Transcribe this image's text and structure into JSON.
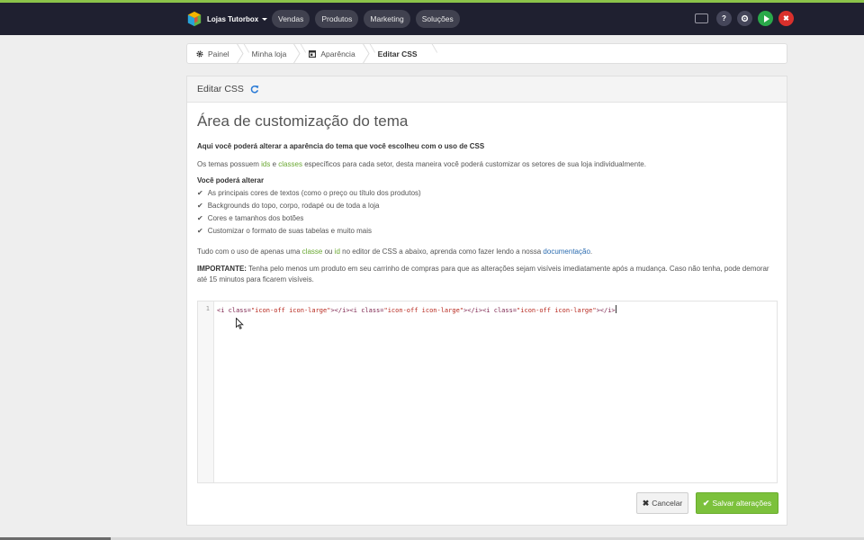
{
  "topbar": {
    "brand": "Lojas Tutorbox",
    "nav": [
      "Vendas",
      "Produtos",
      "Marketing",
      "Soluções"
    ],
    "actions": [
      "screen-icon",
      "question-icon",
      "gear-icon",
      "play-icon",
      "close-icon"
    ],
    "colors": {
      "bar": "#1f2030",
      "accent_stripe": "#8bc34a",
      "green": "#2aa94a",
      "red": "#d9302c"
    }
  },
  "breadcrumb": {
    "items": [
      {
        "label": "Painel",
        "icon": "gear-icon"
      },
      {
        "label": "Minha loja",
        "icon": ""
      },
      {
        "label": "Aparência",
        "icon": "layout-icon"
      },
      {
        "label": "Editar CSS",
        "icon": ""
      }
    ]
  },
  "panel": {
    "title": "Editar CSS",
    "heading": "Área de customização do tema",
    "intro": "Aqui você poderá alterar a aparência do tema que você escolheu com o uso de CSS",
    "themes_para": {
      "part1": "Os temas possuem ",
      "ids": "ids",
      "part2": " e ",
      "classes": "classes",
      "part3": " específicos para cada setor, desta maneira você poderá customizar os setores de sua loja individualmente."
    },
    "can_alter_title": "Você poderá alterar",
    "can_alter_items": [
      "As principais cores de textos (como o preço ou título dos produtos)",
      "Backgrounds do topo, corpo, rodapé ou de toda a loja",
      "Cores e tamanhos dos botões",
      "Customizar o formato de suas tabelas e muito mais"
    ],
    "usage_para": {
      "part1": "Tudo com o uso de apenas uma ",
      "classe": "classe",
      "part2": " ou ",
      "id": "id",
      "part3": " no editor de CSS a abaixo, aprenda como fazer lendo a nossa ",
      "link": "documentação",
      "part4": "."
    },
    "important_label": "IMPORTANTE:",
    "important_text": " Tenha pelo menos um produto em seu carrinho de compras para que as alterações sejam visíveis imediatamente após a mudança. Caso não tenha, pode demorar até 15 minutos para ficarem visíveis."
  },
  "editor": {
    "line_number": "1",
    "tag_open": "<i ",
    "attr": "class=",
    "string_value": "\"icon-off icon-large\"",
    "tag_close": "></i>",
    "repeat": 3
  },
  "buttons": {
    "cancel": "Cancelar",
    "save": "Salvar alterações"
  },
  "video_progress": 0.128
}
